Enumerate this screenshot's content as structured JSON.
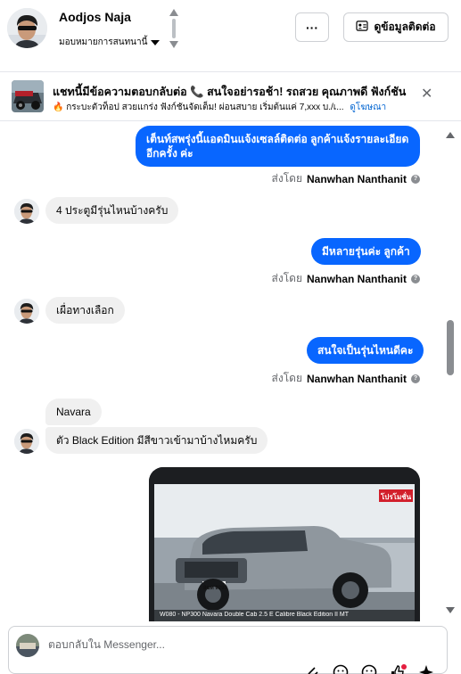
{
  "header": {
    "name": "Aodjos Naja",
    "assign_label": "มอบหมายการสนทนานี้",
    "more_label": "···",
    "contact_label": "ดูข้อมูลติดต่อ"
  },
  "ad": {
    "title": "แชทนี้มีข้อความตอบกลับต่อ 📞 สนใจอย่ารอช้า! รถสวย คุณภาพดี ฟังก์ชัน",
    "text": "🔥 กระบะตัวท็อป สวยแกร่ง ฟังก์ชันจัดเต็ม! ผ่อนสบาย เริ่มต้นแค่ 7,xxx บ./เ...",
    "link_label": "ดูโฆษณา",
    "close_label": "✕"
  },
  "messages": {
    "out1": "เต็นท์สพรุ่งนี้แอดมินแจ้งเซลล์ติดต่อ ลูกค้าแจ้งรายละเอียด\nอีกครั้ง ค่ะ",
    "sent1_prefix": "ส่งโดย",
    "sent1_name": "Nanwhan Nanthanit",
    "in1": "4 ประตูมีรุ่นไหนบ้างครับ",
    "out2": "มีหลายรุ่นค่ะ  ลูกค้า",
    "sent2_prefix": "ส่งโดย",
    "sent2_name": "Nanwhan Nanthanit",
    "in2": "เผื่อทางเลือก",
    "out3": "สนใจเป็นรุ่นไหนดีคะ",
    "sent3_prefix": "ส่งโดย",
    "sent3_name": "Nanwhan Nanthanit",
    "in3": "Navara",
    "in4": "ตัว Black Edition มีสีขาวเข้ามาบ้างไหมครับ",
    "photo_tag": "โปรโมชั่น",
    "photo_plate": "8ฆท 9293",
    "photo_caption": "W080 - NP300 Navara Double Cab 2.5 E Calibre Black Edition II MT"
  },
  "composer": {
    "placeholder": "ตอบกลับใน Messenger..."
  },
  "icons": {
    "more": "more-icon",
    "contact": "contact-card-icon",
    "close": "close-icon",
    "info": "info-icon",
    "attach": "paperclip-icon",
    "emoji": "emoji-icon",
    "sticker": "sticker-icon",
    "like": "thumbs-up-icon",
    "magic": "sparkle-icon"
  },
  "colors": {
    "accent": "#0866ff",
    "incoming_bubble": "#f0f0f0",
    "link": "#0064d1"
  }
}
